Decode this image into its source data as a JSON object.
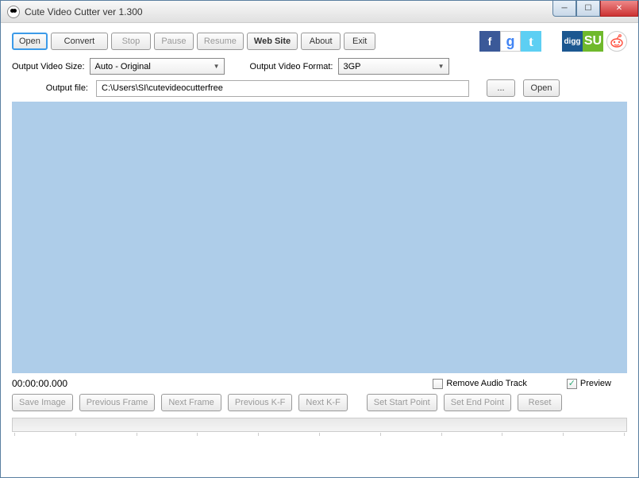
{
  "window": {
    "title": "Cute Video Cutter ver 1.300"
  },
  "toolbar": {
    "open": "Open",
    "convert": "Convert",
    "stop": "Stop",
    "pause": "Pause",
    "resume": "Resume",
    "website": "Web Site",
    "about": "About",
    "exit": "Exit"
  },
  "settings": {
    "size_label": "Output Video Size:",
    "size_value": "Auto - Original",
    "format_label": "Output Video Format:",
    "format_value": "3GP",
    "outfile_label": "Output file:",
    "outfile_value": "C:\\Users\\SI\\cutevideocutterfree",
    "browse": "...",
    "open": "Open"
  },
  "status": {
    "timecode": "00:00:00.000",
    "remove_audio": "Remove Audio Track",
    "preview": "Preview",
    "preview_checked": true,
    "remove_audio_checked": false
  },
  "frame_controls": {
    "save_image": "Save Image",
    "prev_frame": "Previous Frame",
    "next_frame": "Next Frame",
    "prev_kf": "Previous K-F",
    "next_kf": "Next K-F",
    "set_start": "Set  Start Point",
    "set_end": "Set  End Point",
    "reset": "Reset"
  },
  "social": {
    "digg": "digg",
    "su": "SU"
  }
}
